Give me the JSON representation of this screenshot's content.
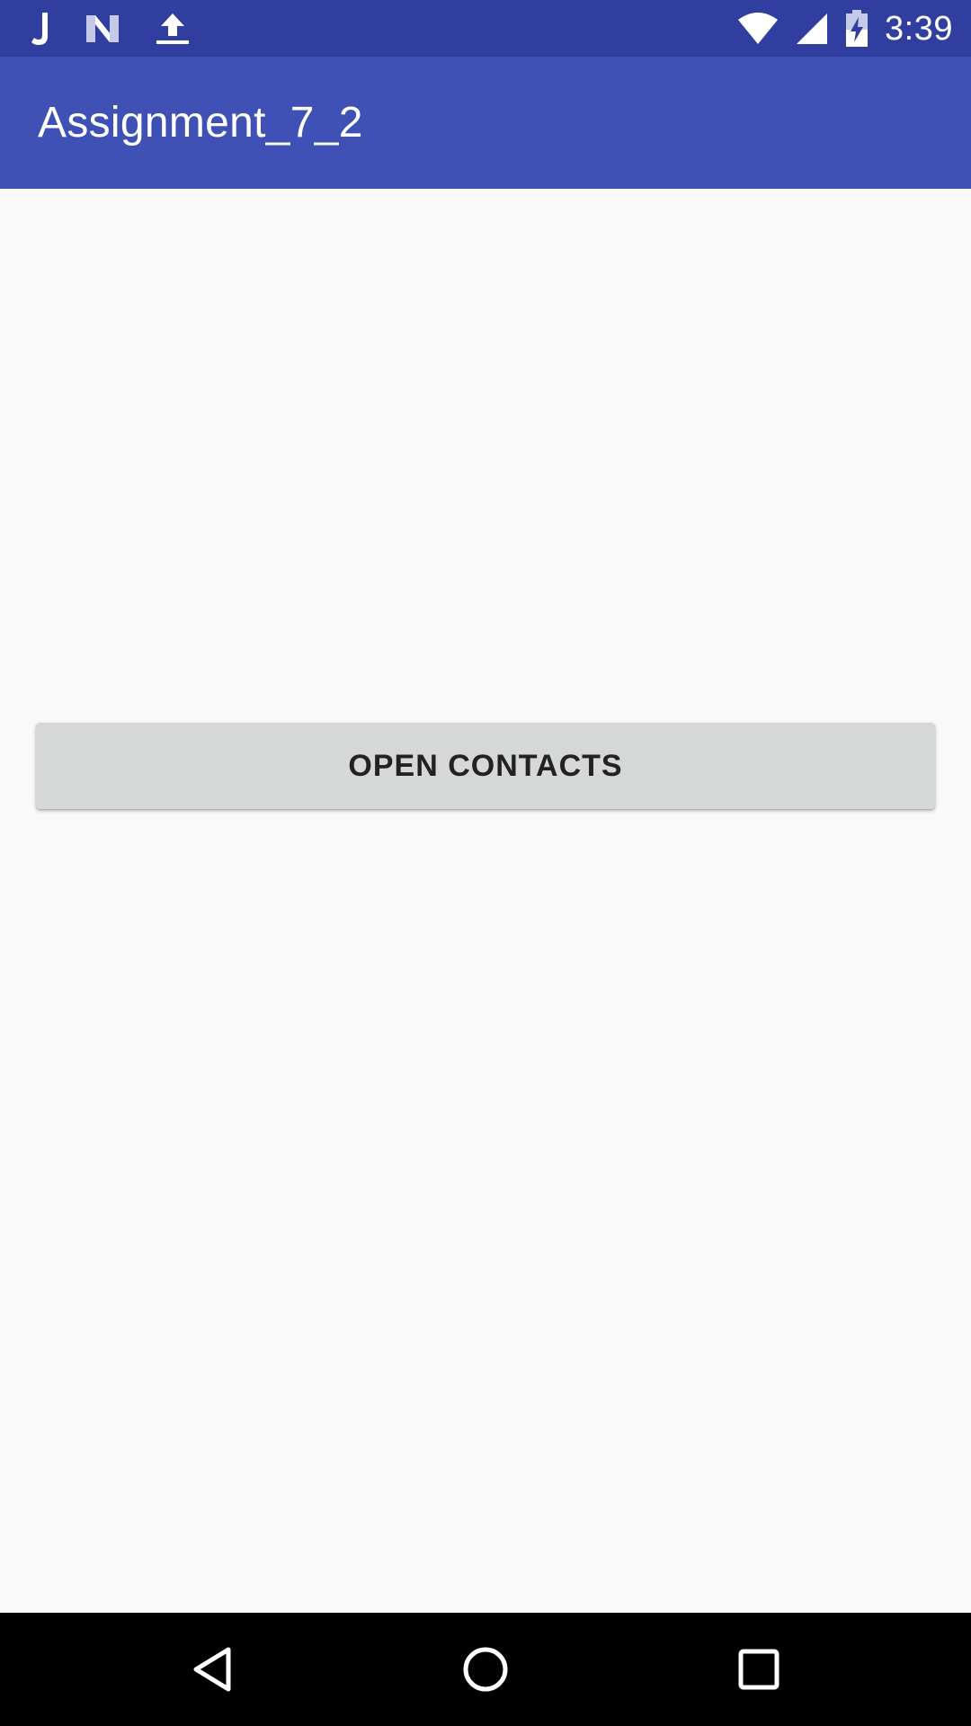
{
  "status_bar": {
    "time": "3:39",
    "left_icons": [
      "j-notification-icon",
      "n-notification-icon",
      "upload-icon"
    ],
    "right_icons": [
      "wifi-icon",
      "cell-signal-icon",
      "battery-charging-icon"
    ]
  },
  "app_bar": {
    "title": "Assignment_7_2"
  },
  "main": {
    "open_contacts_label": "OPEN CONTACTS"
  },
  "nav_bar": {
    "buttons": [
      "back-icon",
      "home-icon",
      "recents-icon"
    ]
  },
  "colors": {
    "status_bar": "#303F9F",
    "app_bar": "#3F51B5",
    "background": "#FAFAFA",
    "button": "#D6D7D7",
    "nav_bar": "#000000"
  }
}
